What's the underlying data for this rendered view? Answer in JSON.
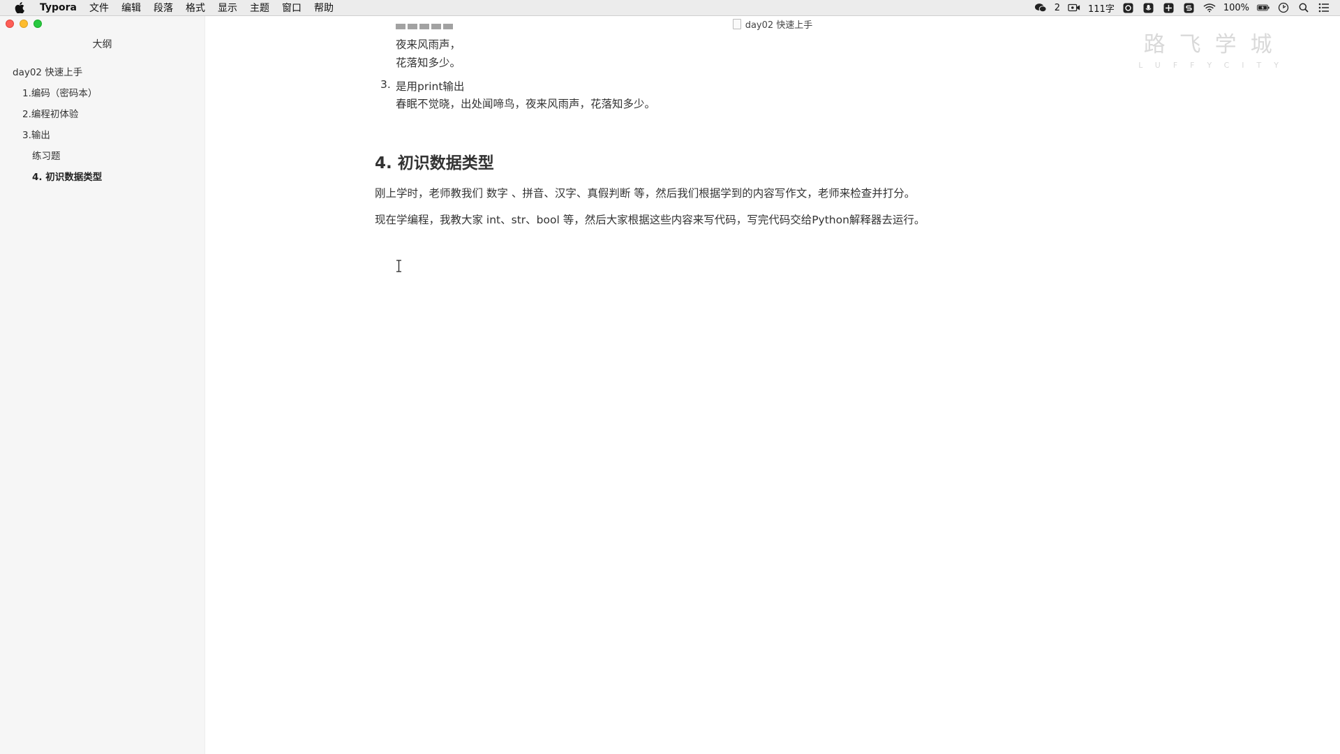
{
  "menubar": {
    "app": "Typora",
    "items": [
      "文件",
      "编辑",
      "段落",
      "格式",
      "显示",
      "主题",
      "窗口",
      "帮助"
    ],
    "status": {
      "wechat_count": "2",
      "word_count": "111字",
      "battery": "100%"
    }
  },
  "sidebar": {
    "title": "大纲",
    "items": [
      {
        "label": "day02 快速上手",
        "level": 1
      },
      {
        "label": "1.编码（密码本）",
        "level": 2
      },
      {
        "label": "2.编程初体验",
        "level": 2
      },
      {
        "label": "3.输出",
        "level": 2
      },
      {
        "label": "练习题",
        "level": 3
      },
      {
        "label": "4. 初识数据类型",
        "level": 3,
        "active": true
      }
    ]
  },
  "window": {
    "title": "day02 快速上手"
  },
  "watermark": {
    "main": "路飞学城",
    "sub": "LUFFYCITY"
  },
  "document": {
    "poem_line_2": "夜来风雨声，",
    "poem_line_3": "花落知多少。",
    "list_item_3_number": "3.",
    "list_item_3_title": "是用print输出",
    "list_item_3_text": "春眠不觉晓，出处闻啼鸟，夜来风雨声，花落知多少。",
    "heading": "4. 初识数据类型",
    "para_1": "刚上学时，老师教我们 数字 、拼音、汉字、真假判断 等，然后我们根据学到的内容写作文，老师来检查并打分。",
    "para_2": "现在学编程，我教大家 int、str、bool 等，然后大家根据这些内容来写代码，写完代码交给Python解释器去运行。"
  }
}
